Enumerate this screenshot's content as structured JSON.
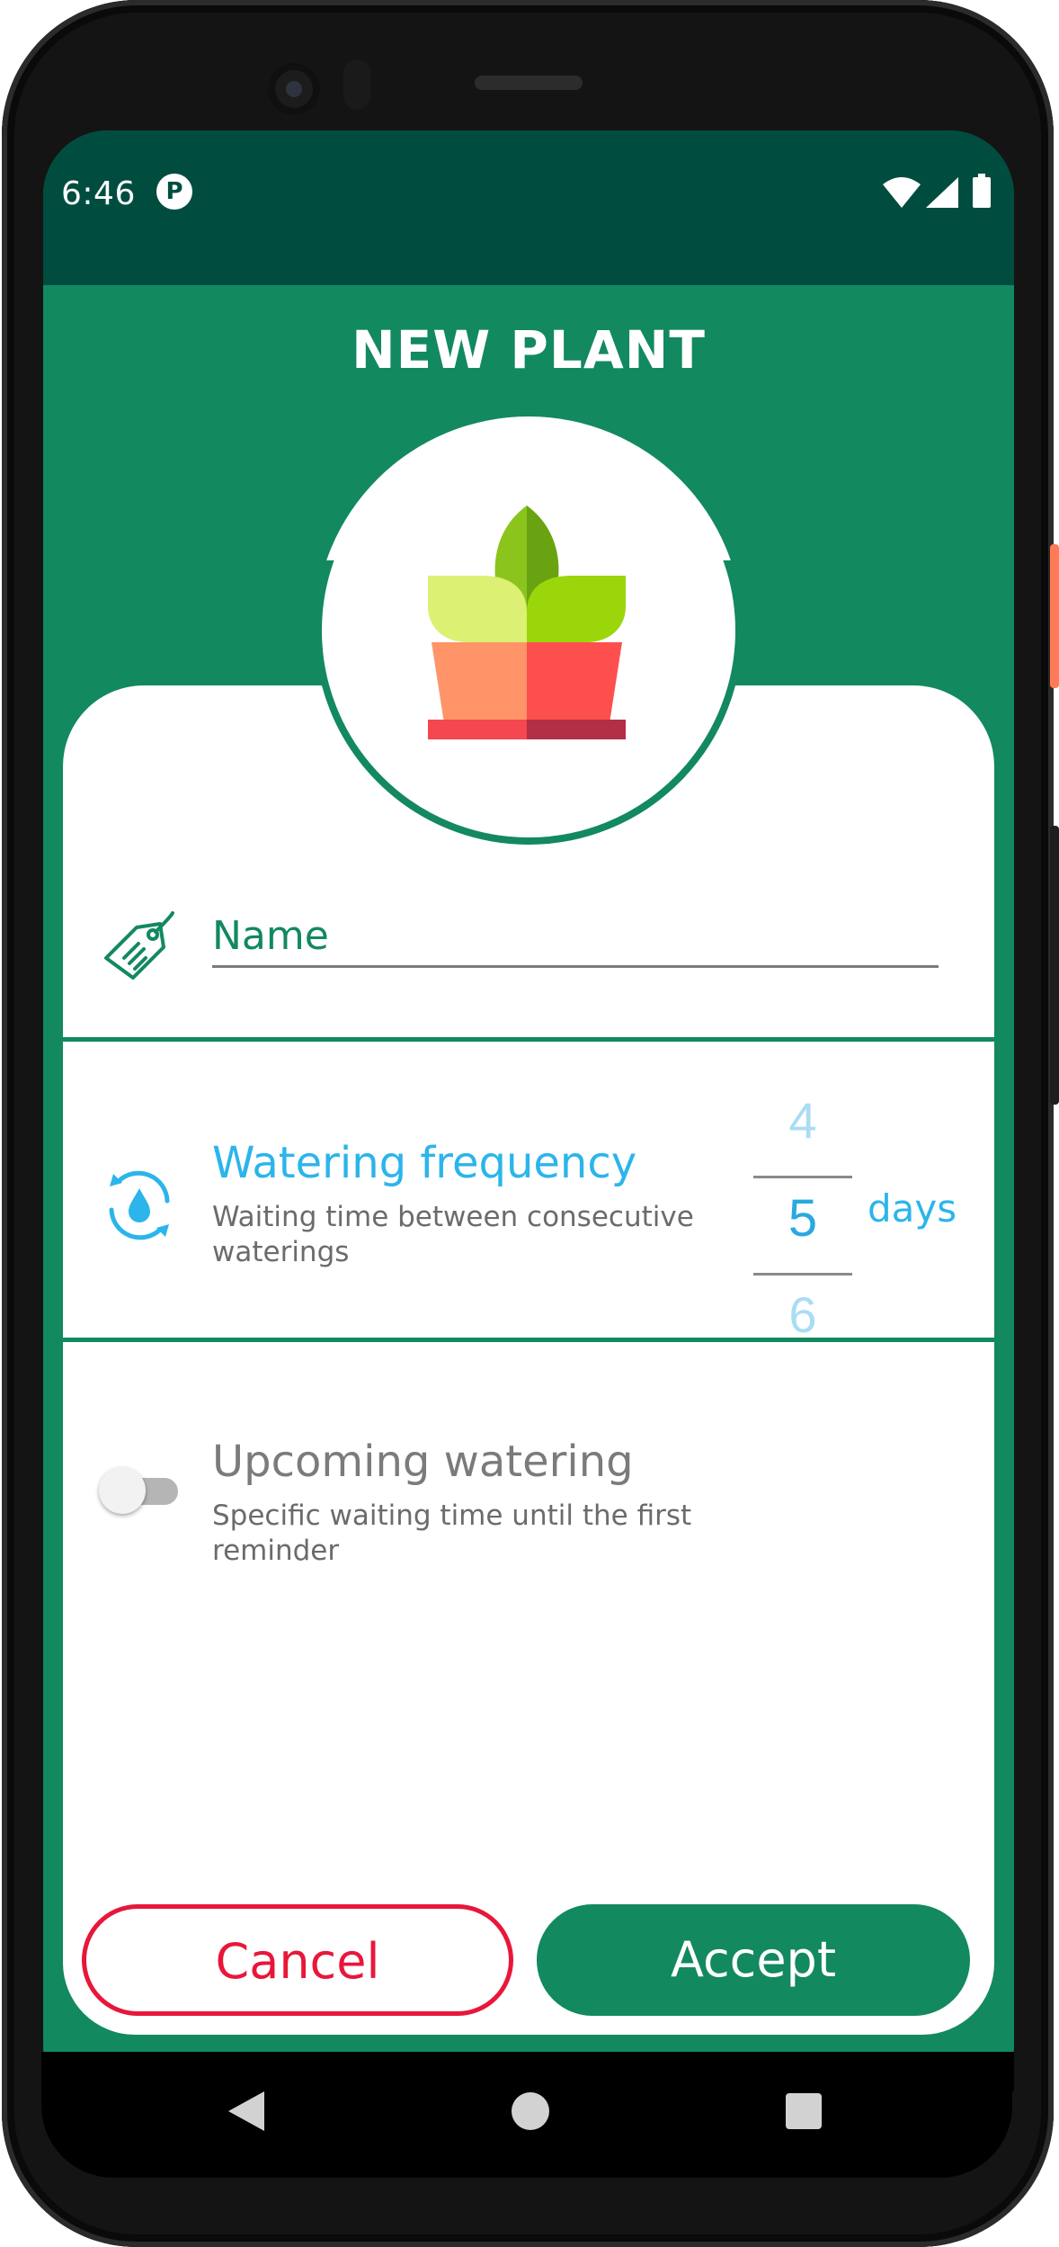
{
  "status_bar": {
    "time": "6:46",
    "app_icon_glyph": "P",
    "icons": [
      "app-notification-icon",
      "wifi-icon",
      "signal-icon",
      "battery-icon"
    ]
  },
  "header": {
    "title": "NEW PLANT"
  },
  "plant_image": {
    "icon": "potted-plant-icon"
  },
  "name_field": {
    "icon": "tag-icon",
    "placeholder": "Name",
    "value": ""
  },
  "watering_frequency": {
    "icon": "water-cycle-icon",
    "title": "Watering frequency",
    "description": "Waiting time between consecutive waterings",
    "picker": {
      "previous": "4",
      "selected": "5",
      "next": "6"
    },
    "unit": "days"
  },
  "upcoming_watering": {
    "title": "Upcoming watering",
    "description": "Specific waiting time until the first reminder",
    "enabled": false
  },
  "actions": {
    "cancel_label": "Cancel",
    "accept_label": "Accept"
  },
  "navigation_bar": {
    "icons": [
      "back-icon",
      "home-icon",
      "recents-icon"
    ]
  },
  "colors": {
    "primary": "#12895f",
    "status_bar": "#004d40",
    "accent_blue": "#2bb5ea",
    "cancel_red": "#e8173a"
  }
}
